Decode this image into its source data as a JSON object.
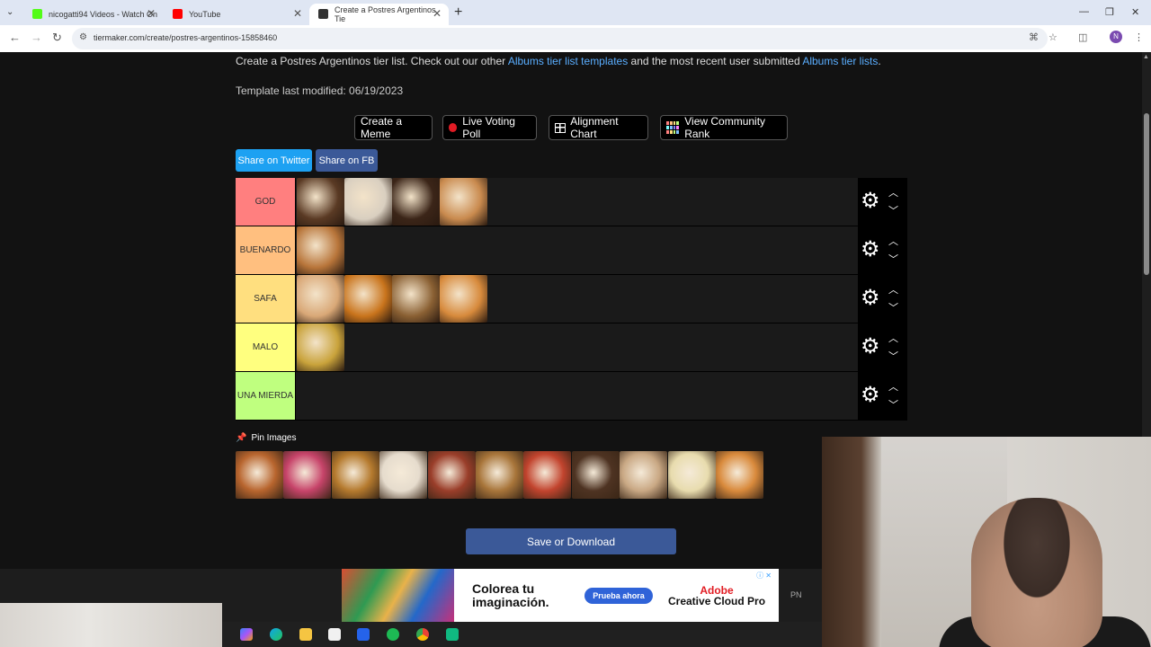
{
  "browser": {
    "tabs": [
      {
        "title": "nicogatti94 Videos - Watch On",
        "color": "#53fc18"
      },
      {
        "title": "YouTube",
        "color": "#ff0000"
      },
      {
        "title": "Create a Postres Argentinos Tie",
        "color": "#333333"
      }
    ],
    "url": "tiermaker.com/create/postres-argentinos-15858460",
    "profile_initial": "N"
  },
  "page": {
    "intro_prefix": "Create a Postres Argentinos tier list. Check out our other ",
    "intro_link1": "Albums tier list templates",
    "intro_mid": " and the most recent user submitted ",
    "intro_link2": "Albums tier lists",
    "intro_suffix": ".",
    "modified": "Template last modified: 06/19/2023",
    "tools": {
      "meme": "Create a Meme",
      "poll": "Live Voting Poll",
      "alignment": "Alignment Chart",
      "community": "View Community Rank"
    },
    "share_twitter": "Share on Twitter",
    "share_fb": "Share on FB",
    "pin_images": "Pin Images",
    "save": "Save or Download"
  },
  "tiers": [
    {
      "label": "GOD",
      "color": "#ff7f7f",
      "items": [
        "#5a3a24",
        "#d9cfc0",
        "#3b2518",
        "#c98a4e"
      ]
    },
    {
      "label": "BUENARDO",
      "color": "#ffbf7f",
      "items": [
        "#b8753a"
      ]
    },
    {
      "label": "SAFA",
      "color": "#ffdf7f",
      "items": [
        "#d9a877",
        "#c9741c",
        "#8a6033",
        "#d78a3c"
      ]
    },
    {
      "label": "MALO",
      "color": "#ffff7f",
      "items": [
        "#c9a33b"
      ]
    },
    {
      "label": "UNA MIERDA",
      "color": "#bfff7f",
      "items": []
    }
  ],
  "pool": [
    "#b8652e",
    "#c7446a",
    "#b57a2e",
    "#e6dccd",
    "#9a3e2a",
    "#a8753a",
    "#c2442e",
    "#4e3322",
    "#c9a884",
    "#e8dcae",
    "#d98a3c"
  ],
  "ad": {
    "headline": "Colorea tu imaginación.",
    "cta": "Prueba ahora",
    "brand1": "Adobe",
    "brand2": "Creative Cloud Pro",
    "tag": "PN"
  }
}
